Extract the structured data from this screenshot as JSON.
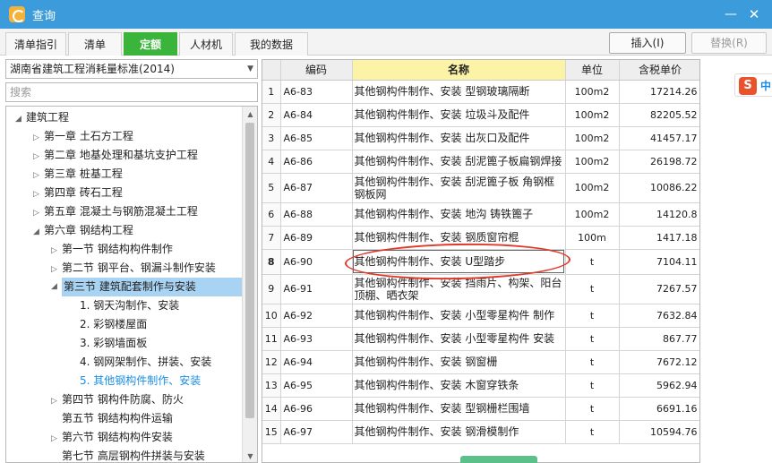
{
  "window": {
    "title": "查询",
    "minimize_glyph": "—",
    "close_glyph": "✕"
  },
  "tabs": [
    {
      "label": "清单指引",
      "active": false
    },
    {
      "label": "清单",
      "active": false
    },
    {
      "label": "定额",
      "active": true
    },
    {
      "label": "人材机",
      "active": false
    },
    {
      "label": "我的数据",
      "active": false
    }
  ],
  "toolbar": {
    "insert_label": "插入(I)",
    "replace_label": "替换(R)"
  },
  "library": {
    "selected": "湖南省建筑工程消耗量标准(2014)"
  },
  "search": {
    "placeholder": "搜索"
  },
  "tree": [
    {
      "label": "建筑工程",
      "arrow": "◢",
      "state": ""
    },
    {
      "label": "第一章  土石方工程",
      "arrow": "▷",
      "state": ""
    },
    {
      "label": "第二章  地基处理和基坑支护工程",
      "arrow": "▷",
      "state": ""
    },
    {
      "label": "第三章  桩基工程",
      "arrow": "▷",
      "state": ""
    },
    {
      "label": "第四章  砖石工程",
      "arrow": "▷",
      "state": ""
    },
    {
      "label": "第五章  混凝土与钢筋混凝土工程",
      "arrow": "▷",
      "state": ""
    },
    {
      "label": "第六章  钢结构工程",
      "arrow": "◢",
      "state": ""
    },
    {
      "label": "第一节  钢结构构件制作",
      "arrow": "▷",
      "state": ""
    },
    {
      "label": "第二节  钢平台、钢漏斗制作安装",
      "arrow": "▷",
      "state": ""
    },
    {
      "label": "第三节  建筑配套制作与安装",
      "arrow": "◢",
      "state": "selected"
    },
    {
      "label": "1.  钢天沟制作、安装",
      "arrow": "",
      "state": ""
    },
    {
      "label": "2.  彩钢楼屋面",
      "arrow": "",
      "state": ""
    },
    {
      "label": "3.  彩钢墙面板",
      "arrow": "",
      "state": ""
    },
    {
      "label": "4.  钢网架制作、拼装、安装",
      "arrow": "",
      "state": ""
    },
    {
      "label": "5.  其他钢构件制作、安装",
      "arrow": "",
      "state": "active"
    },
    {
      "label": "第四节  钢构件防腐、防火",
      "arrow": "▷",
      "state": ""
    },
    {
      "label": "第五节  钢结构构件运输",
      "arrow": "",
      "state": ""
    },
    {
      "label": "第六节  钢结构构件安装",
      "arrow": "▷",
      "state": ""
    },
    {
      "label": "第七节  高层钢构件拼装与安装",
      "arrow": "",
      "state": ""
    }
  ],
  "grid": {
    "headers": {
      "code": "编码",
      "name": "名称",
      "unit": "单位",
      "price": "含税单价"
    },
    "rows": [
      {
        "no": "1",
        "code": "A6-83",
        "name": "其他钢构件制作、安装  型钢玻璃隔断",
        "unit": "100m2",
        "price": "17214.26"
      },
      {
        "no": "2",
        "code": "A6-84",
        "name": "其他钢构件制作、安装  垃圾斗及配件",
        "unit": "100m2",
        "price": "82205.52"
      },
      {
        "no": "3",
        "code": "A6-85",
        "name": "其他钢构件制作、安装  出灰口及配件",
        "unit": "100m2",
        "price": "41457.17"
      },
      {
        "no": "4",
        "code": "A6-86",
        "name": "其他钢构件制作、安装  刮泥篦子板扁钢焊接",
        "unit": "100m2",
        "price": "26198.72"
      },
      {
        "no": "5",
        "code": "A6-87",
        "name": "其他钢构件制作、安装  刮泥篦子板  角钢框钢板网",
        "unit": "100m2",
        "price": "10086.22"
      },
      {
        "no": "6",
        "code": "A6-88",
        "name": "其他钢构件制作、安装  地沟  铸铁篦子",
        "unit": "100m2",
        "price": "14120.8"
      },
      {
        "no": "7",
        "code": "A6-89",
        "name": "其他钢构件制作、安装  钢质窗帘棍",
        "unit": "100m",
        "price": "1417.18"
      },
      {
        "no": "8",
        "code": "A6-90",
        "name": "其他钢构件制作、安装  U型踏步",
        "unit": "t",
        "price": "7104.11"
      },
      {
        "no": "9",
        "code": "A6-91",
        "name": "其他钢构件制作、安装  挡雨片、构架、阳台顶棚、晒衣架",
        "unit": "t",
        "price": "7267.57"
      },
      {
        "no": "10",
        "code": "A6-92",
        "name": "其他钢构件制作、安装  小型零星构件  制作",
        "unit": "t",
        "price": "7632.84"
      },
      {
        "no": "11",
        "code": "A6-93",
        "name": "其他钢构件制作、安装  小型零星构件  安装",
        "unit": "t",
        "price": "867.77"
      },
      {
        "no": "12",
        "code": "A6-94",
        "name": "其他钢构件制作、安装  钢窗栅",
        "unit": "t",
        "price": "7672.12"
      },
      {
        "no": "13",
        "code": "A6-95",
        "name": "其他钢构件制作、安装  木窗穿铁条",
        "unit": "t",
        "price": "5962.94"
      },
      {
        "no": "14",
        "code": "A6-96",
        "name": "其他钢构件制作、安装  型钢栅栏围墙",
        "unit": "t",
        "price": "6691.16"
      },
      {
        "no": "15",
        "code": "A6-97",
        "name": "其他钢构件制作、安装  钢滑模制作",
        "unit": "t",
        "price": "10594.76"
      }
    ]
  },
  "ime": {
    "logo": "S",
    "mode": "中"
  }
}
